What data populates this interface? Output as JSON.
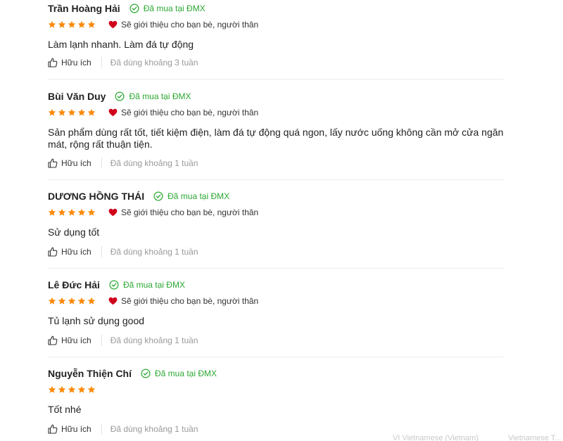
{
  "reviews": [
    {
      "name": "Trần Hoàng Hải",
      "bought": "Đã mua tại ĐMX",
      "stars": 5,
      "recommend": "Sẽ giới thiệu cho bạn bè, người thân",
      "content": "Làm lạnh nhanh. Làm đá tự động",
      "helpful": "Hữu ích",
      "used": "Đã dùng khoảng 3 tuần"
    },
    {
      "name": "Bùi Văn Duy",
      "bought": "Đã mua tại ĐMX",
      "stars": 5,
      "recommend": "Sẽ giới thiệu cho bạn bè, người thân",
      "content": "Sản phẩm dùng rất tốt, tiết kiệm điện, làm đá tự động quá ngon, lấy nước uống không cần mở cửa ngăn mát, rộng rất thuận tiện.",
      "helpful": "Hữu ích",
      "used": "Đã dùng khoảng 1 tuần"
    },
    {
      "name": "DƯƠNG HỒNG THÁI",
      "bought": "Đã mua tại ĐMX",
      "stars": 5,
      "recommend": "Sẽ giới thiệu cho bạn bè, người thân",
      "content": "Sử dụng tốt",
      "helpful": "Hữu ích",
      "used": "Đã dùng khoảng 1 tuần"
    },
    {
      "name": "Lê Đức Hải",
      "bought": "Đã mua tại ĐMX",
      "stars": 5,
      "recommend": "Sẽ giới thiệu cho bạn bè, người thân",
      "content": "Tủ lạnh sử dụng good",
      "helpful": "Hữu ích",
      "used": "Đã dùng khoảng 1 tuần"
    },
    {
      "name": "Nguyễn Thiện Chí",
      "bought": "Đã mua tại ĐMX",
      "stars": 5,
      "recommend": "",
      "content": "Tốt nhé",
      "helpful": "Hữu ích",
      "used": "Đã dùng khoảng 1 tuần"
    }
  ],
  "overlay": {
    "lang_left": "VI  Vietnamese (Vietnam)",
    "lang_right": "Vietnamese T..."
  },
  "colors": {
    "star": "#fd8a0c",
    "bought": "#2ba832",
    "heart": "#d0021b",
    "muted": "#9a9a9a"
  },
  "icons": {
    "star": "star-icon",
    "bought": "check-circle-icon",
    "recommend": "heart-icon",
    "helpful": "thumbs-up-icon"
  }
}
